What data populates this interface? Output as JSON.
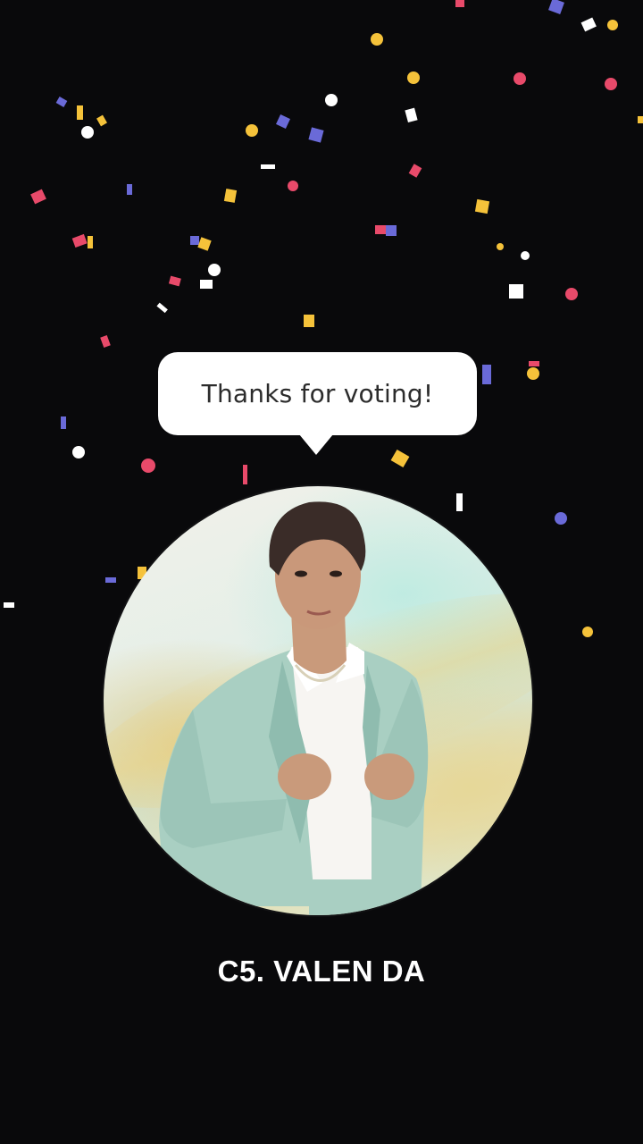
{
  "message": {
    "text": "Thanks for voting!"
  },
  "contestant": {
    "name": "C5. VALEN DA",
    "photo_icon": "contestant-photo"
  },
  "colors": {
    "background": "#09090b",
    "bubble": "#ffffff",
    "name_text": "#ffffff",
    "confetti": [
      "#f5c23a",
      "#e84a6a",
      "#6a6ad8",
      "#ffffff"
    ]
  }
}
